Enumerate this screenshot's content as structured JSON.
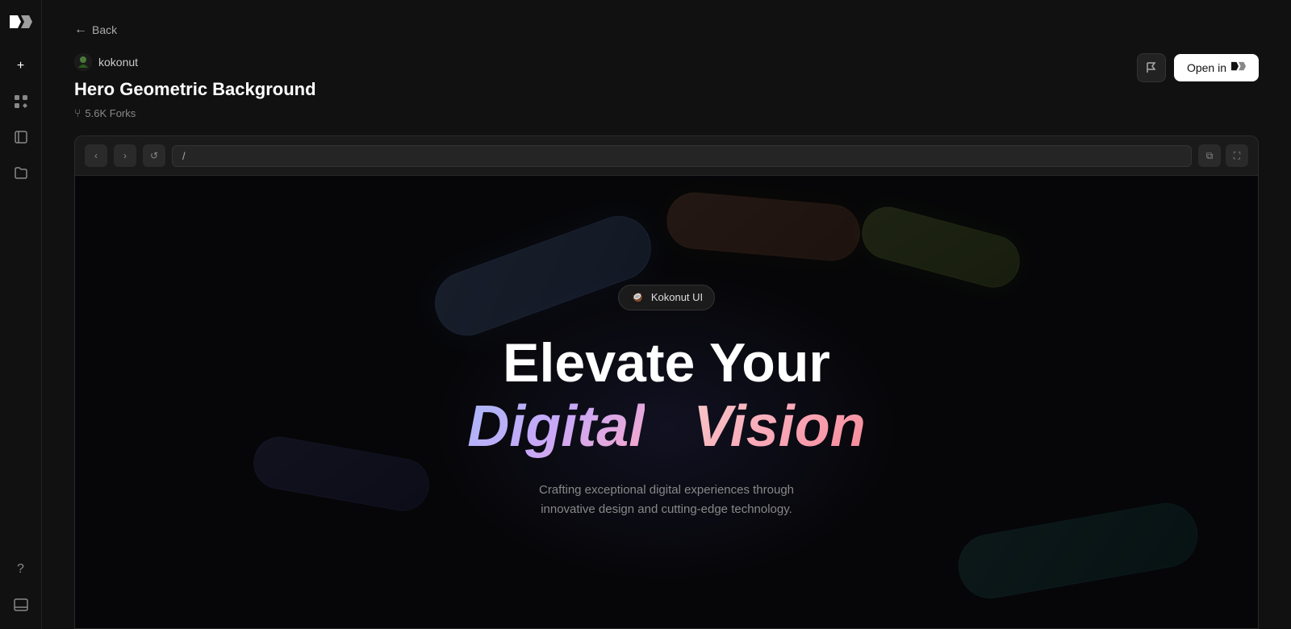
{
  "sidebar": {
    "logo_label": "v0",
    "nav_items": [
      {
        "name": "add",
        "icon": "+"
      },
      {
        "name": "components",
        "icon": "⊞"
      },
      {
        "name": "book",
        "icon": "📖"
      },
      {
        "name": "folder",
        "icon": "📁"
      }
    ],
    "bottom_items": [
      {
        "name": "help",
        "icon": "?"
      },
      {
        "name": "panel",
        "icon": "▭"
      }
    ]
  },
  "header": {
    "back_label": "Back",
    "author": "kokonut",
    "project_title": "Hero Geometric Background",
    "forks_count": "5.6K Forks",
    "flag_title": "Flag",
    "open_button_label": "Open in",
    "open_button_logo": "v0"
  },
  "browser": {
    "back_btn": "‹",
    "forward_btn": "›",
    "refresh_btn": "↺",
    "address_bar_value": "/",
    "new_tab_icon": "⧉",
    "fullscreen_icon": "⛶"
  },
  "hero": {
    "badge_text": "Kokonut UI",
    "title_line1": "Elevate Your",
    "title_word_digital": "Digital",
    "title_word_vision": "Vision",
    "subtitle_line1": "Crafting exceptional digital experiences through",
    "subtitle_line2": "innovative design and cutting-edge technology."
  }
}
